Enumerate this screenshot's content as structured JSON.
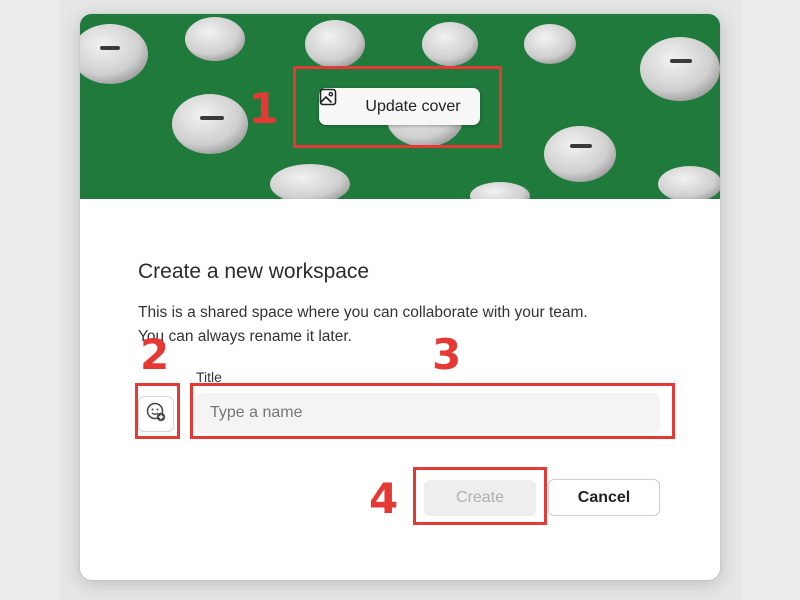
{
  "dialog": {
    "cover_button_label": "Update cover",
    "title": "Create a new workspace",
    "description_line1": "This is a shared space where you can collaborate with your team.",
    "description_line2": "You can always rename it later.",
    "field_label": "Title",
    "title_placeholder": "Type a name",
    "title_value": "",
    "create_label": "Create",
    "cancel_label": "Cancel",
    "create_enabled": false
  },
  "annotations": [
    {
      "number": "1",
      "target": "update-cover-button"
    },
    {
      "number": "2",
      "target": "emoji-picker-button"
    },
    {
      "number": "3",
      "target": "title-input"
    },
    {
      "number": "4",
      "target": "create-button"
    }
  ],
  "colors": {
    "cover_green": "#1f7a3c",
    "annotation_red": "#e53935",
    "disabled_text": "#b0b0b0"
  },
  "icons": {
    "cover_button": "image-icon",
    "emoji_button": "emoji-add-icon"
  }
}
